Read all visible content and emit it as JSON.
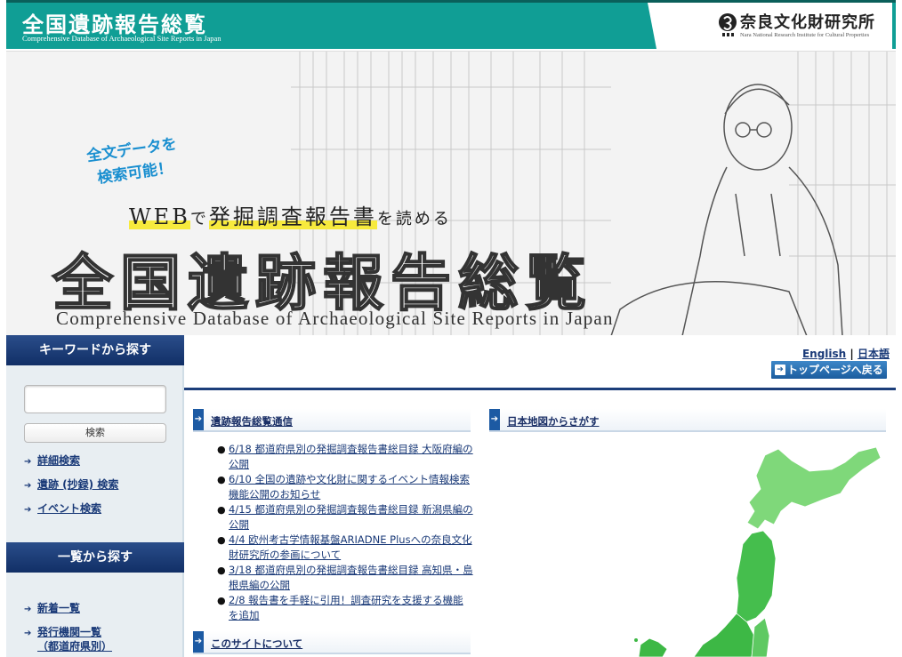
{
  "header": {
    "title_jp": "全国遺跡報告総覧",
    "title_en": "Comprehensive Database of Archaeological Site Reports in Japan",
    "org_jp": "奈良文化財研究所",
    "org_en": "Nara National Research Institute for Cultural Properties",
    "logo_icon": "nabunken-logo-icon",
    "accent_color": "#109e95"
  },
  "banner": {
    "handwrite_line1": "全文データを",
    "handwrite_line2": "検索可能！",
    "catch_web": "WEB",
    "catch_de": "で",
    "catch_report": "発掘調査報告書",
    "catch_read": "を読める",
    "title": "全国遺跡報告総覧",
    "subtitle": "Comprehensive Database of Archaeological Site Reports in Japan"
  },
  "sidebar": {
    "keyword_heading": "キーワードから探す",
    "search_placeholder": "",
    "search_button": "検索",
    "keyword_links": [
      "詳細検索",
      "遺跡 (抄録) 検索",
      "イベント検索"
    ],
    "list_heading": "一覧から探す",
    "list_links": [
      "新着一覧",
      "発行機関一覧",
      "（都道府県別）"
    ],
    "heading_color": "#1c3e7a"
  },
  "lang": {
    "english": "English",
    "separator": "|",
    "japanese": "日本語"
  },
  "top_button": "トップページへ戻る",
  "news": {
    "heading": "遺跡報告総覧通信",
    "items": [
      "6/18 都道府県別の発掘調査報告書総目録 大阪府編の公開",
      "6/10 全国の遺跡や文化財に関するイベント情報検索機能公開のお知らせ",
      "4/15 都道府県別の発掘調査報告書総目録 新潟県編の公開",
      "4/4 欧州考古学情報基盤ARIADNE Plusへの奈良文化財研究所の参画について",
      "3/18 都道府県別の発掘調査報告書総目録 高知県・島根県編の公開",
      "2/8 報告書を手軽に引用！調査研究を支援する機能を追加"
    ]
  },
  "about": {
    "heading": "このサイトについて"
  },
  "map_section": {
    "heading": "日本地図からさがす",
    "map_color_light": "#7fd87a",
    "map_color_dark": "#3db845"
  }
}
